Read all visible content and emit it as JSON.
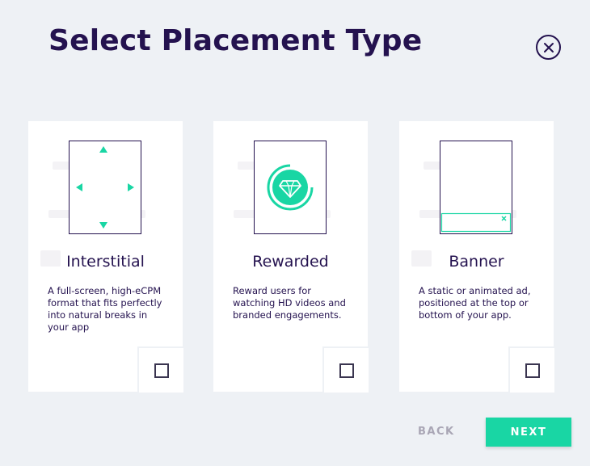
{
  "page": {
    "title": "Select Placement Type"
  },
  "colors": {
    "accent": "#19d6a4",
    "text": "#24124f",
    "background": "#eef1f5"
  },
  "cards": [
    {
      "title": "Interstitial",
      "description": "A full-screen, high-eCPM format that fits perfectly into natural breaks in your app",
      "icon": "interstitial-phone-arrows-icon",
      "checked": false
    },
    {
      "title": "Rewarded",
      "description": "Reward users for watching HD videos and branded engagements.",
      "icon": "rewarded-diamond-icon",
      "checked": false
    },
    {
      "title": "Banner",
      "description": "A static or animated ad, positioned at the top or bottom of your app.",
      "icon": "banner-phone-icon",
      "checked": false
    }
  ],
  "footer": {
    "back_label": "BACK",
    "next_label": "NEXT"
  }
}
